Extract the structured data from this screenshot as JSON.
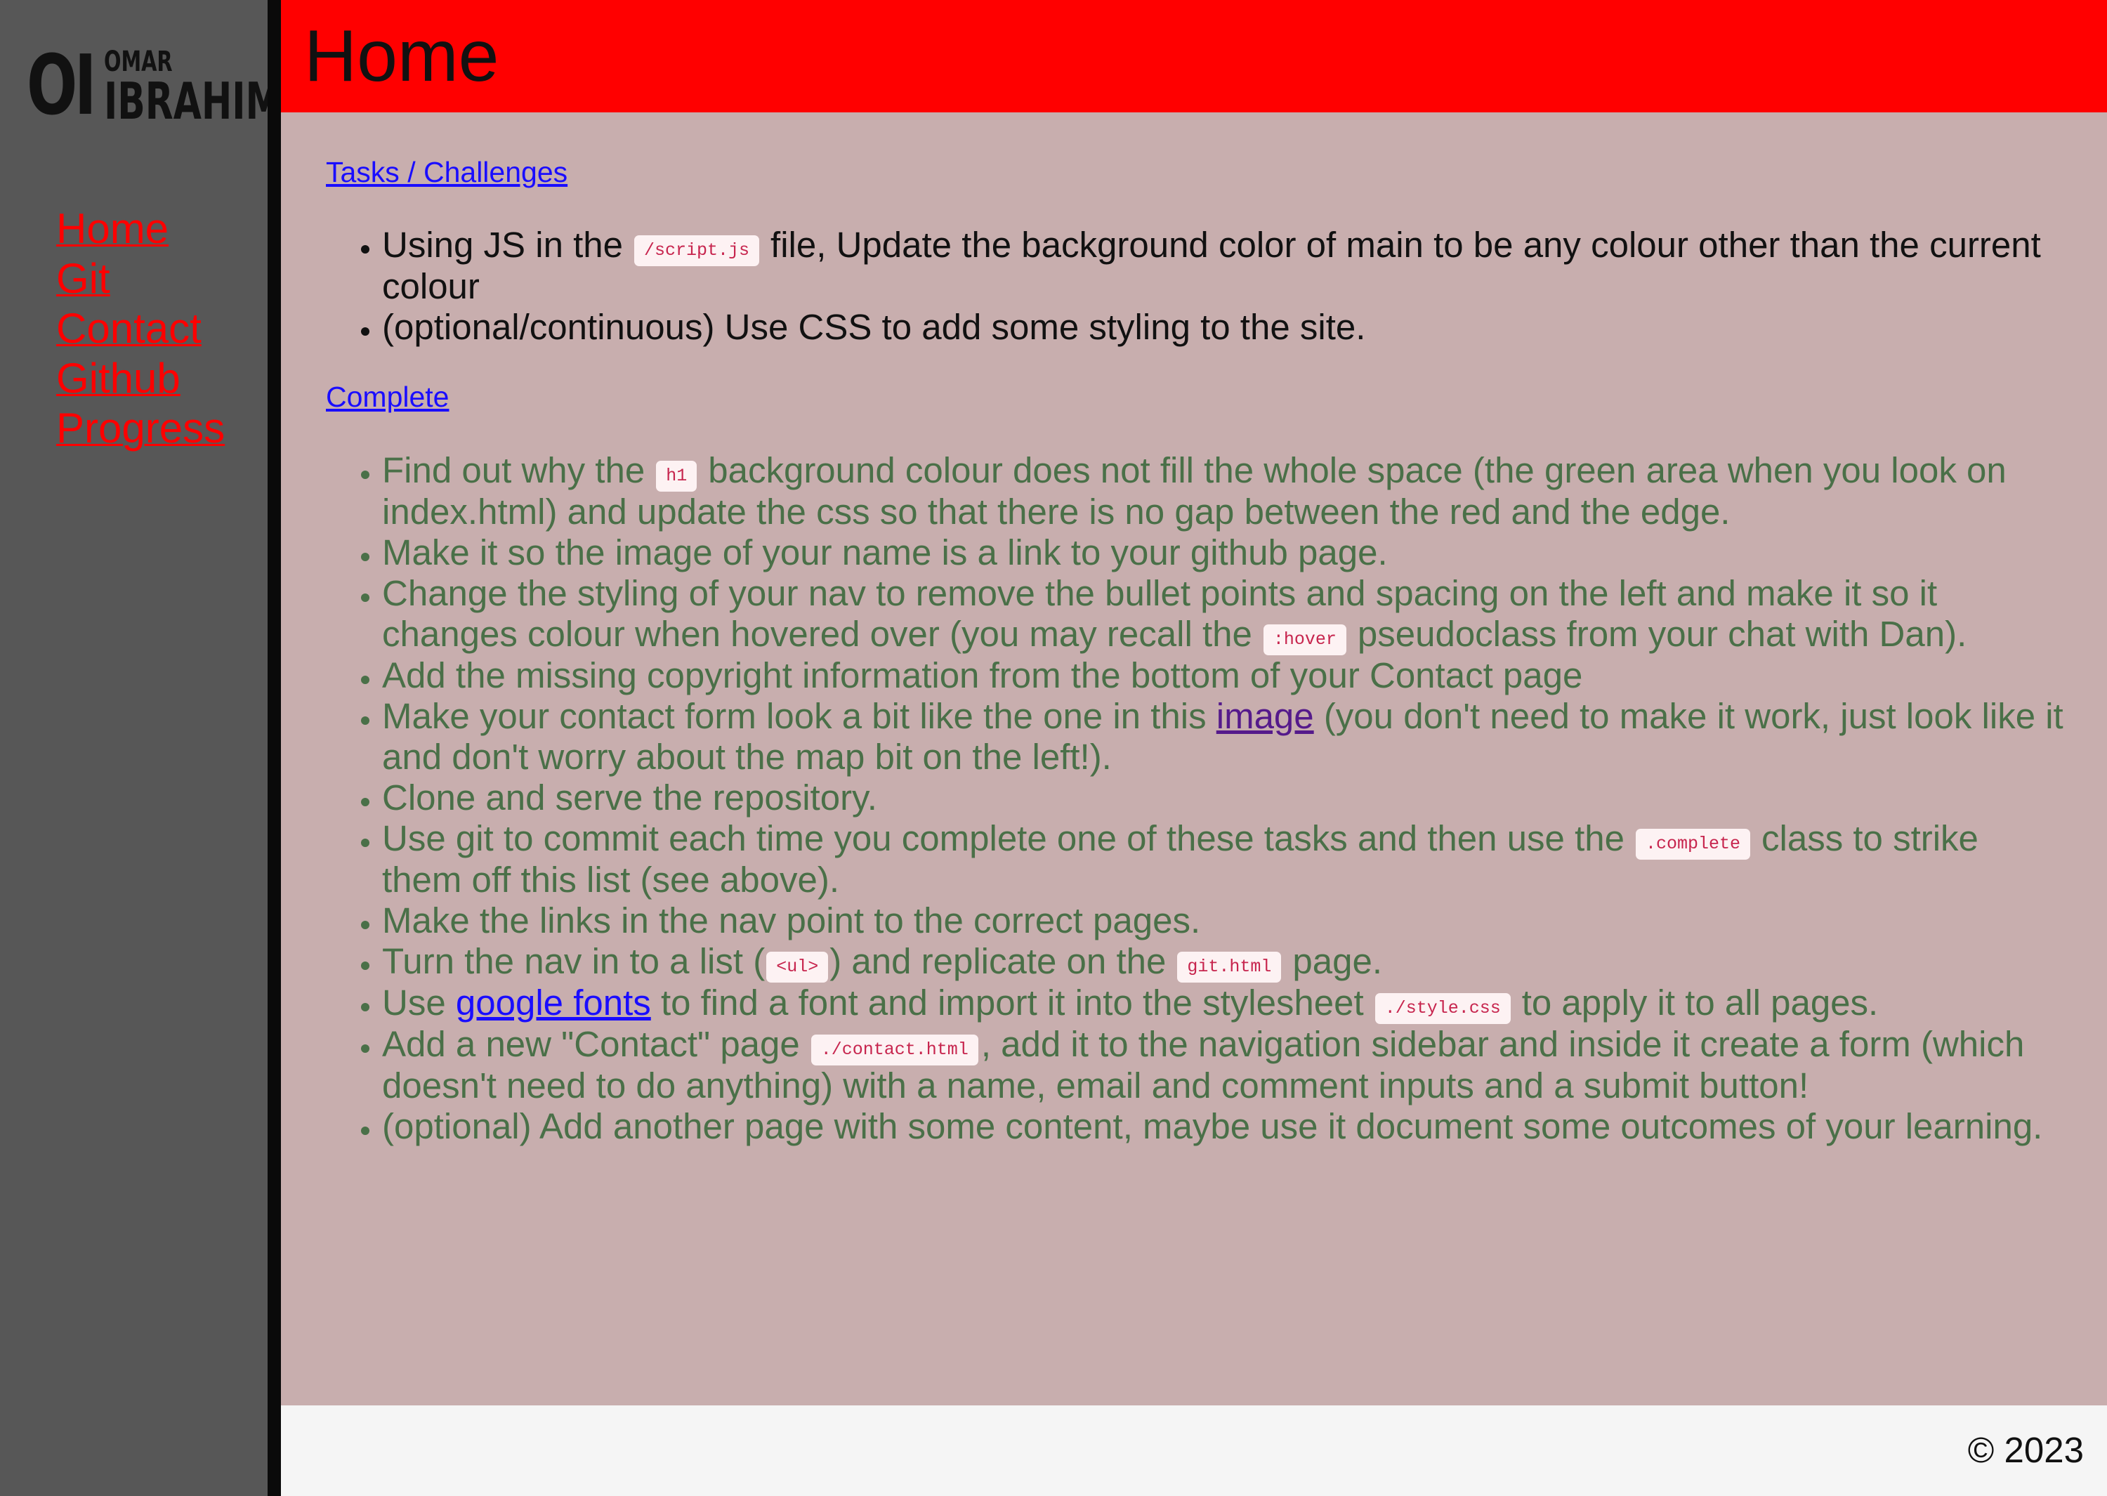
{
  "logo": {
    "initials": "OI",
    "first_name": "OMAR",
    "last_name": "IBRAHIM"
  },
  "nav": [
    {
      "label": "Home"
    },
    {
      "label": "Git"
    },
    {
      "label": "Contact"
    },
    {
      "label": "Github"
    },
    {
      "label": "Progress"
    }
  ],
  "header": {
    "title": "Home"
  },
  "tasks": {
    "link_label": "Tasks / Challenges",
    "items": [
      {
        "text_a": "Using JS in the",
        "code_a": "/script.js",
        "text_b": "file, Update the background color of main to be any colour other than the current colour"
      },
      {
        "text_a": "(optional/continuous) Use CSS to add some styling to the site."
      }
    ]
  },
  "complete": {
    "link_label": "Complete",
    "items": [
      {
        "text_a": "Find out why the",
        "code_a": "h1",
        "text_b": "background colour does not fill the whole space (the green area when you look on index.html) and update the css so that there is no gap between the red and the edge."
      },
      {
        "text_a": "Make it so the image of your name is a link to your github page."
      },
      {
        "text_a": "Change the styling of your nav to remove the bullet points and spacing on the left and make it so it changes colour when hovered over (you may recall the",
        "code_a": ":hover",
        "text_b": "pseudoclass from your chat with Dan)."
      },
      {
        "text_a": "Add the missing copyright information from the bottom of your Contact page"
      },
      {
        "text_a": "Make your contact form look a bit like the one in this",
        "link_a": "image",
        "text_b": "(you don't need to make it work, just look like it and don't worry about the map bit on the left!)."
      },
      {
        "text_a": "Clone and serve the repository."
      },
      {
        "text_a": "Use git to commit each time you complete one of these tasks and then use the",
        "code_a": ".complete",
        "text_b": "class to strike them off this list (see above)."
      },
      {
        "text_a": "Make the links in the nav point to the correct pages."
      },
      {
        "text_a": "Turn the nav in to a list (",
        "code_a": "<ul>",
        "text_b": ") and replicate on the",
        "code_b": "git.html",
        "text_c": "page."
      },
      {
        "text_a": "Use",
        "link_a": "google fonts",
        "text_b": "to find a font and import it into the stylesheet",
        "code_a": "./style.css",
        "text_c": "to apply it to all pages."
      },
      {
        "text_a": "Add a new \"Contact\" page",
        "code_a": "./contact.html",
        "text_b": ", add it to the navigation sidebar and inside it create a form (which doesn't need to do anything) with a name, email and comment inputs and a submit button!"
      },
      {
        "text_a": "(optional) Add another page with some content, maybe use it document some outcomes of your learning."
      }
    ]
  },
  "footer": {
    "copyright": "© 2023"
  },
  "colors": {
    "sidebar": "#575757",
    "header": "#ff0000",
    "main": "#c8aeae",
    "completed_text": "#4a7048",
    "nav_link": "#ff0000"
  }
}
